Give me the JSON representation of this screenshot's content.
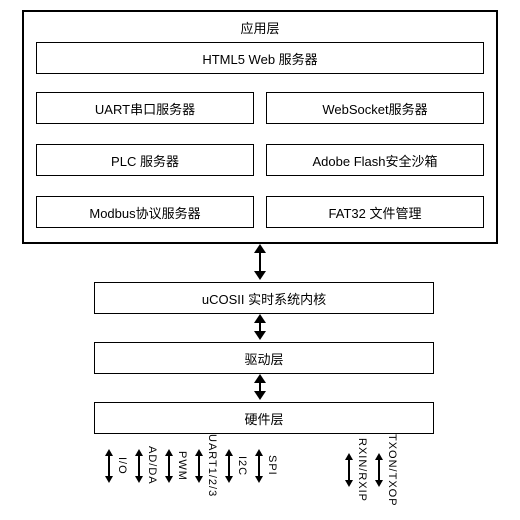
{
  "app_layer": {
    "title": "应用层",
    "blocks": {
      "html5": "HTML5 Web 服务器",
      "uart": "UART串口服务器",
      "websocket": "WebSocket服务器",
      "plc": "PLC 服务器",
      "flash": "Adobe Flash安全沙箱",
      "modbus": "Modbus协议服务器",
      "fat32": "FAT32 文件管理"
    }
  },
  "kernel": "uCOSII 实时系统内核",
  "driver": "驱动层",
  "hardware": "硬件层",
  "hw_signals": {
    "group1": [
      "I/O",
      "AD/DA",
      "PWM",
      "UART1/2/3",
      "I2C",
      "SPI"
    ],
    "group2": [
      "RXIN/RXIP",
      "TXON/TXOP"
    ]
  }
}
